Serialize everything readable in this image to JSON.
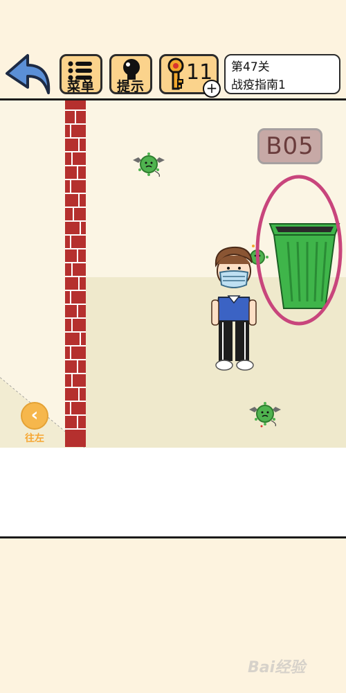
{
  "toolbar": {
    "menu_label": "菜单",
    "hint_label": "提示",
    "key_count": "11",
    "level_number": "第47关",
    "level_name": "战疫指南1"
  },
  "scene": {
    "room_code": "B05",
    "go_left_label": "往左"
  },
  "watermark": "Bai经验",
  "colors": {
    "background": "#fdf3df",
    "button_fill": "#fbd38c",
    "bin_green": "#3fb54a",
    "highlight_circle": "#c8457c",
    "brick_red": "#b5302e"
  }
}
